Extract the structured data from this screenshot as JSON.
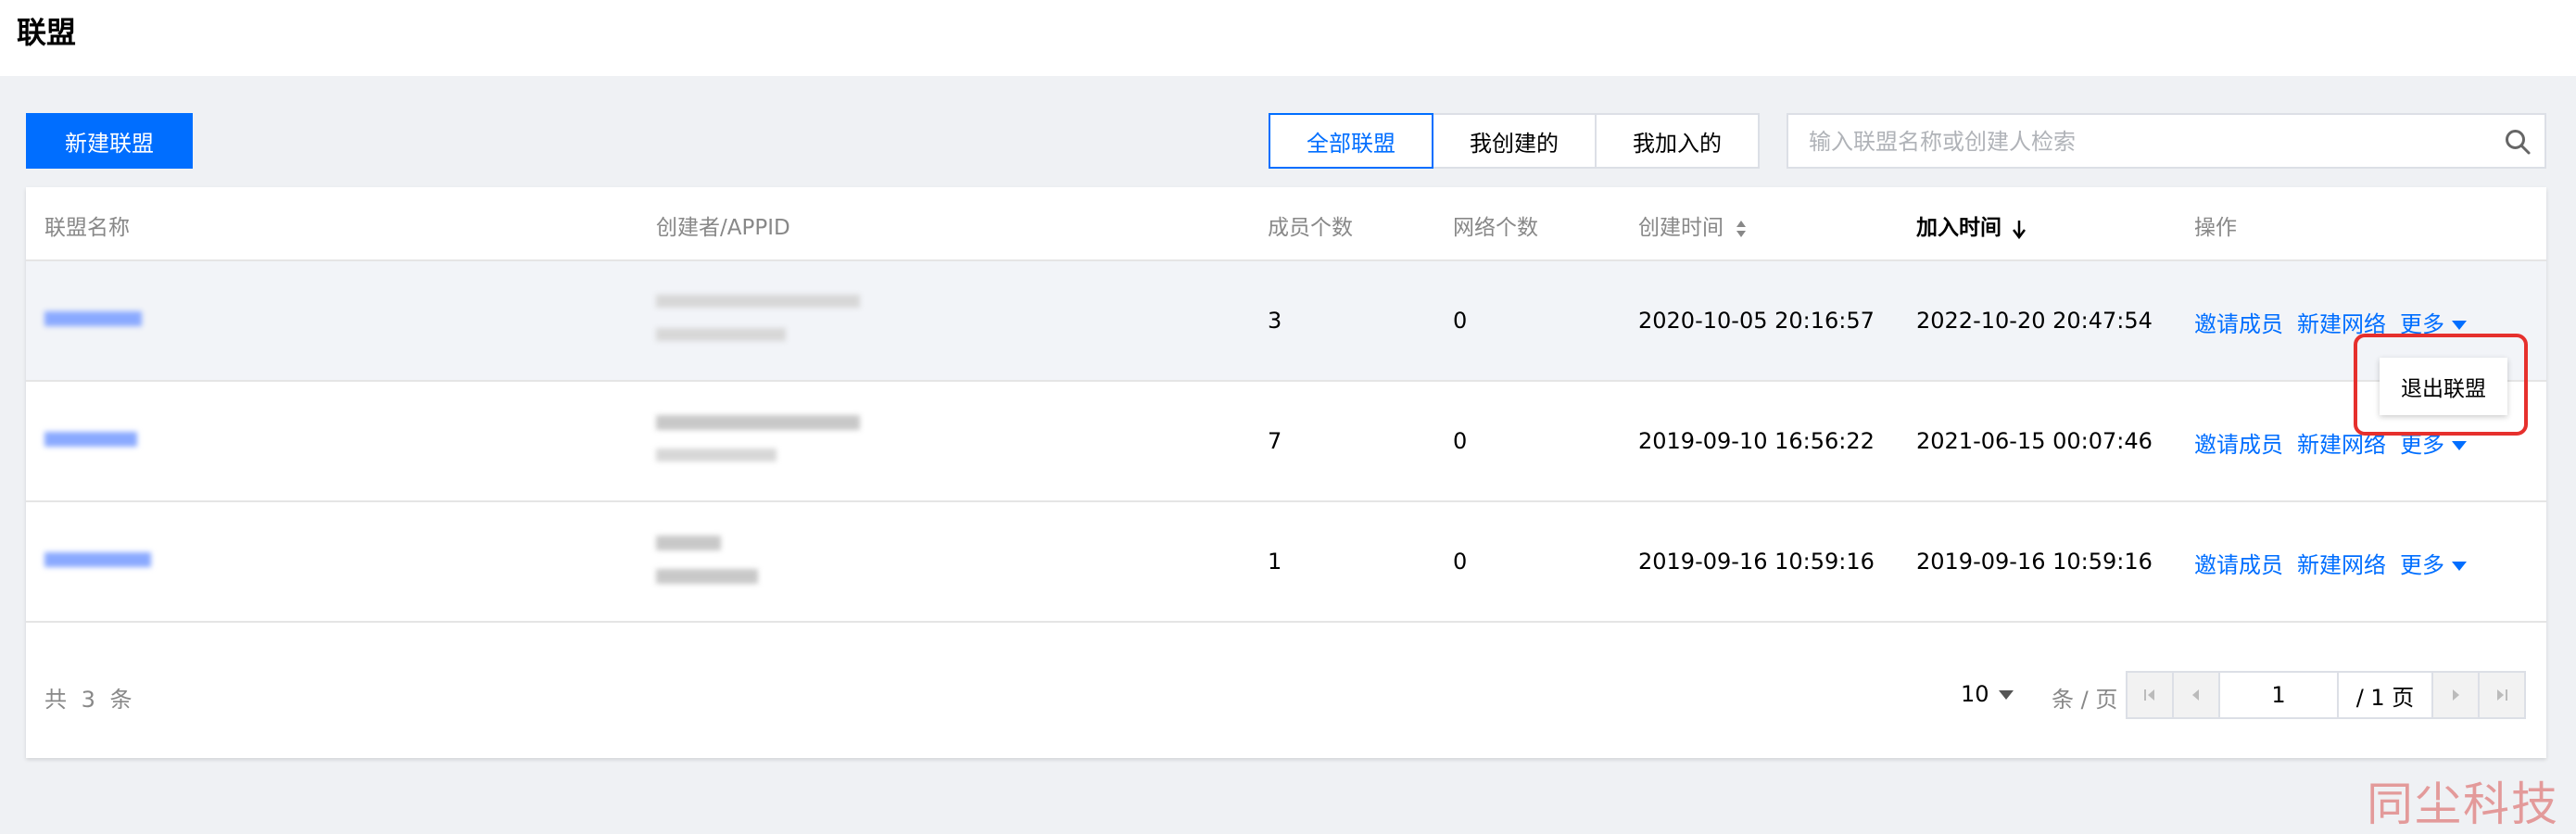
{
  "page": {
    "title": "联盟"
  },
  "toolbar": {
    "new_button_label": "新建联盟",
    "filters": [
      "全部联盟",
      "我创建的",
      "我加入的"
    ],
    "active_filter": "全部联盟",
    "search_placeholder": "输入联盟名称或创建人检索"
  },
  "table": {
    "columns": [
      "联盟名称",
      "创建者/APPID",
      "成员个数",
      "网络个数",
      "创建时间",
      "加入时间",
      "操作"
    ],
    "rows": [
      {
        "members": "3",
        "networks": "0",
        "created": "2020-10-05 20:16:57",
        "joined": "2022-10-20 20:47:54",
        "ops": [
          "邀请成员",
          "新建网络",
          "更多"
        ]
      },
      {
        "members": "7",
        "networks": "0",
        "created": "2019-09-10 16:56:22",
        "joined": "2021-06-15 00:07:46",
        "ops": [
          "邀请成员",
          "新建网络",
          "更多"
        ]
      },
      {
        "members": "1",
        "networks": "0",
        "created": "2019-09-16 10:59:16",
        "joined": "2019-09-16 10:59:16",
        "ops": [
          "邀请成员",
          "新建网络",
          "更多"
        ]
      }
    ]
  },
  "footer": {
    "total": "共 3 条",
    "page_size": "10",
    "per_page_label": "条 / 页",
    "current_page": "1",
    "total_pages": "/ 1 页"
  },
  "popover": {
    "item": "退出联盟"
  },
  "watermark": "同尘科技",
  "colors": {
    "accent": "#006eff",
    "highlight": "#e6302d",
    "hover_row": "#f2f4f8"
  }
}
